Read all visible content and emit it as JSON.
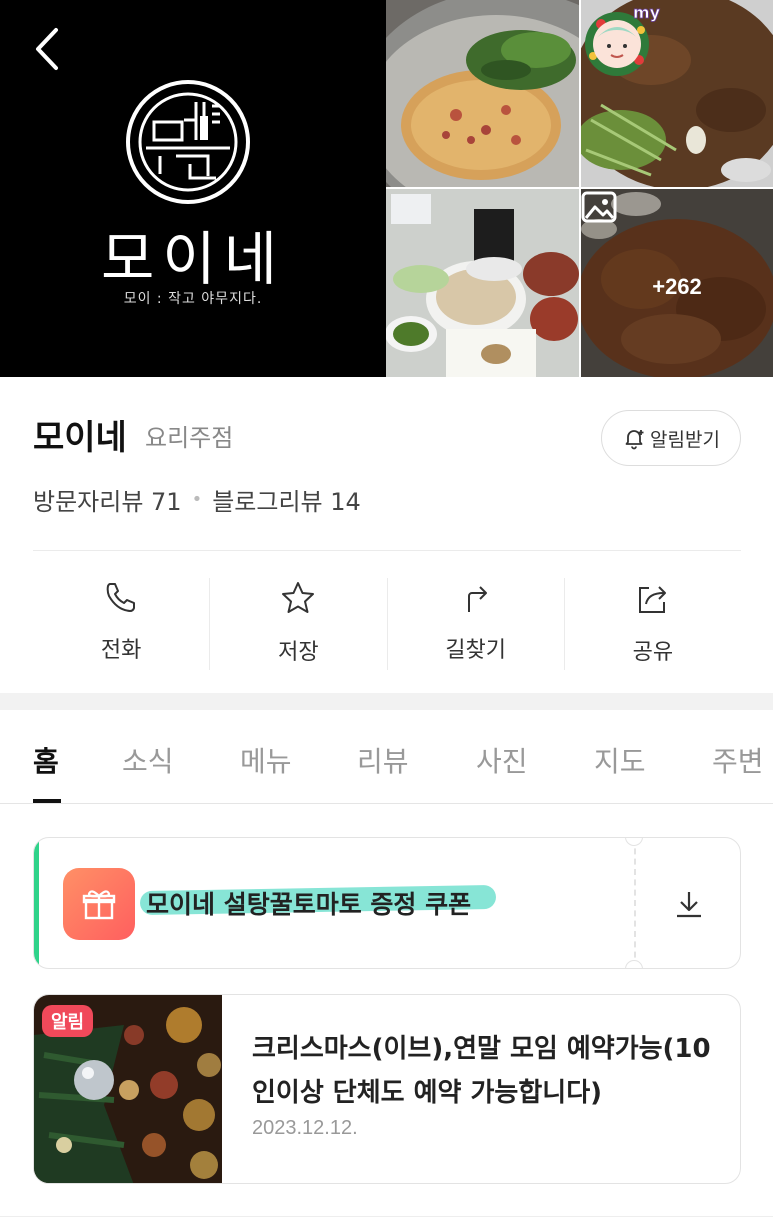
{
  "hero": {
    "logo_name": "모이네",
    "logo_tagline": "모이 : 작고 야무지다.",
    "my_badge": "my",
    "more_photos": "+262"
  },
  "place": {
    "name": "모이네",
    "category": "요리주점",
    "notify_label": "알림받기",
    "visitor_reviews": "방문자리뷰 71",
    "blog_reviews": "블로그리뷰 14",
    "separator": "•"
  },
  "actions": [
    {
      "label": "전화",
      "icon": "phone-icon"
    },
    {
      "label": "저장",
      "icon": "star-icon"
    },
    {
      "label": "길찾기",
      "icon": "directions-icon"
    },
    {
      "label": "공유",
      "icon": "share-icon"
    }
  ],
  "tabs": [
    "홈",
    "소식",
    "메뉴",
    "리뷰",
    "사진",
    "지도",
    "주변"
  ],
  "active_tab": "홈",
  "coupon": {
    "title": "모이네 설탕꿀토마토 증정 쿠폰",
    "accent_color": "#2fd38a",
    "highlight_color": "#72e0cf"
  },
  "news": {
    "badge": "알림",
    "title": "크리스마스(이브),연말 모임 예약가능(10인이상 단체도 예약 가능합니다)",
    "date": "2023.12.12."
  }
}
